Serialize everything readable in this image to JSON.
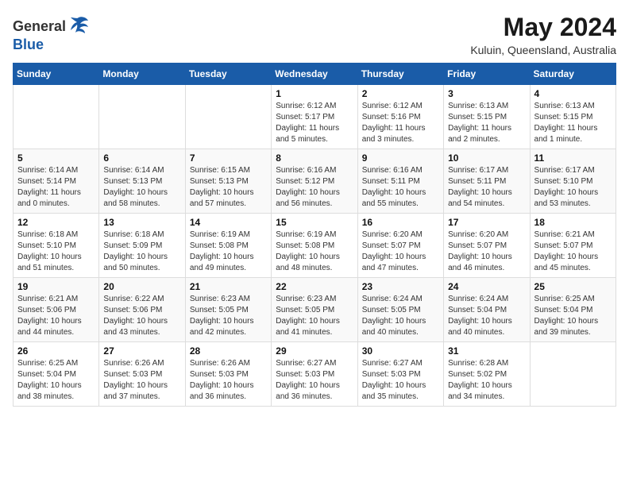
{
  "logo": {
    "general": "General",
    "blue": "Blue"
  },
  "header": {
    "month_year": "May 2024",
    "location": "Kuluin, Queensland, Australia"
  },
  "days_of_week": [
    "Sunday",
    "Monday",
    "Tuesday",
    "Wednesday",
    "Thursday",
    "Friday",
    "Saturday"
  ],
  "weeks": [
    [
      {
        "day": "",
        "info": ""
      },
      {
        "day": "",
        "info": ""
      },
      {
        "day": "",
        "info": ""
      },
      {
        "day": "1",
        "info": "Sunrise: 6:12 AM\nSunset: 5:17 PM\nDaylight: 11 hours\nand 5 minutes."
      },
      {
        "day": "2",
        "info": "Sunrise: 6:12 AM\nSunset: 5:16 PM\nDaylight: 11 hours\nand 3 minutes."
      },
      {
        "day": "3",
        "info": "Sunrise: 6:13 AM\nSunset: 5:15 PM\nDaylight: 11 hours\nand 2 minutes."
      },
      {
        "day": "4",
        "info": "Sunrise: 6:13 AM\nSunset: 5:15 PM\nDaylight: 11 hours\nand 1 minute."
      }
    ],
    [
      {
        "day": "5",
        "info": "Sunrise: 6:14 AM\nSunset: 5:14 PM\nDaylight: 11 hours\nand 0 minutes."
      },
      {
        "day": "6",
        "info": "Sunrise: 6:14 AM\nSunset: 5:13 PM\nDaylight: 10 hours\nand 58 minutes."
      },
      {
        "day": "7",
        "info": "Sunrise: 6:15 AM\nSunset: 5:13 PM\nDaylight: 10 hours\nand 57 minutes."
      },
      {
        "day": "8",
        "info": "Sunrise: 6:16 AM\nSunset: 5:12 PM\nDaylight: 10 hours\nand 56 minutes."
      },
      {
        "day": "9",
        "info": "Sunrise: 6:16 AM\nSunset: 5:11 PM\nDaylight: 10 hours\nand 55 minutes."
      },
      {
        "day": "10",
        "info": "Sunrise: 6:17 AM\nSunset: 5:11 PM\nDaylight: 10 hours\nand 54 minutes."
      },
      {
        "day": "11",
        "info": "Sunrise: 6:17 AM\nSunset: 5:10 PM\nDaylight: 10 hours\nand 53 minutes."
      }
    ],
    [
      {
        "day": "12",
        "info": "Sunrise: 6:18 AM\nSunset: 5:10 PM\nDaylight: 10 hours\nand 51 minutes."
      },
      {
        "day": "13",
        "info": "Sunrise: 6:18 AM\nSunset: 5:09 PM\nDaylight: 10 hours\nand 50 minutes."
      },
      {
        "day": "14",
        "info": "Sunrise: 6:19 AM\nSunset: 5:08 PM\nDaylight: 10 hours\nand 49 minutes."
      },
      {
        "day": "15",
        "info": "Sunrise: 6:19 AM\nSunset: 5:08 PM\nDaylight: 10 hours\nand 48 minutes."
      },
      {
        "day": "16",
        "info": "Sunrise: 6:20 AM\nSunset: 5:07 PM\nDaylight: 10 hours\nand 47 minutes."
      },
      {
        "day": "17",
        "info": "Sunrise: 6:20 AM\nSunset: 5:07 PM\nDaylight: 10 hours\nand 46 minutes."
      },
      {
        "day": "18",
        "info": "Sunrise: 6:21 AM\nSunset: 5:07 PM\nDaylight: 10 hours\nand 45 minutes."
      }
    ],
    [
      {
        "day": "19",
        "info": "Sunrise: 6:21 AM\nSunset: 5:06 PM\nDaylight: 10 hours\nand 44 minutes."
      },
      {
        "day": "20",
        "info": "Sunrise: 6:22 AM\nSunset: 5:06 PM\nDaylight: 10 hours\nand 43 minutes."
      },
      {
        "day": "21",
        "info": "Sunrise: 6:23 AM\nSunset: 5:05 PM\nDaylight: 10 hours\nand 42 minutes."
      },
      {
        "day": "22",
        "info": "Sunrise: 6:23 AM\nSunset: 5:05 PM\nDaylight: 10 hours\nand 41 minutes."
      },
      {
        "day": "23",
        "info": "Sunrise: 6:24 AM\nSunset: 5:05 PM\nDaylight: 10 hours\nand 40 minutes."
      },
      {
        "day": "24",
        "info": "Sunrise: 6:24 AM\nSunset: 5:04 PM\nDaylight: 10 hours\nand 40 minutes."
      },
      {
        "day": "25",
        "info": "Sunrise: 6:25 AM\nSunset: 5:04 PM\nDaylight: 10 hours\nand 39 minutes."
      }
    ],
    [
      {
        "day": "26",
        "info": "Sunrise: 6:25 AM\nSunset: 5:04 PM\nDaylight: 10 hours\nand 38 minutes."
      },
      {
        "day": "27",
        "info": "Sunrise: 6:26 AM\nSunset: 5:03 PM\nDaylight: 10 hours\nand 37 minutes."
      },
      {
        "day": "28",
        "info": "Sunrise: 6:26 AM\nSunset: 5:03 PM\nDaylight: 10 hours\nand 36 minutes."
      },
      {
        "day": "29",
        "info": "Sunrise: 6:27 AM\nSunset: 5:03 PM\nDaylight: 10 hours\nand 36 minutes."
      },
      {
        "day": "30",
        "info": "Sunrise: 6:27 AM\nSunset: 5:03 PM\nDaylight: 10 hours\nand 35 minutes."
      },
      {
        "day": "31",
        "info": "Sunrise: 6:28 AM\nSunset: 5:02 PM\nDaylight: 10 hours\nand 34 minutes."
      },
      {
        "day": "",
        "info": ""
      }
    ]
  ]
}
